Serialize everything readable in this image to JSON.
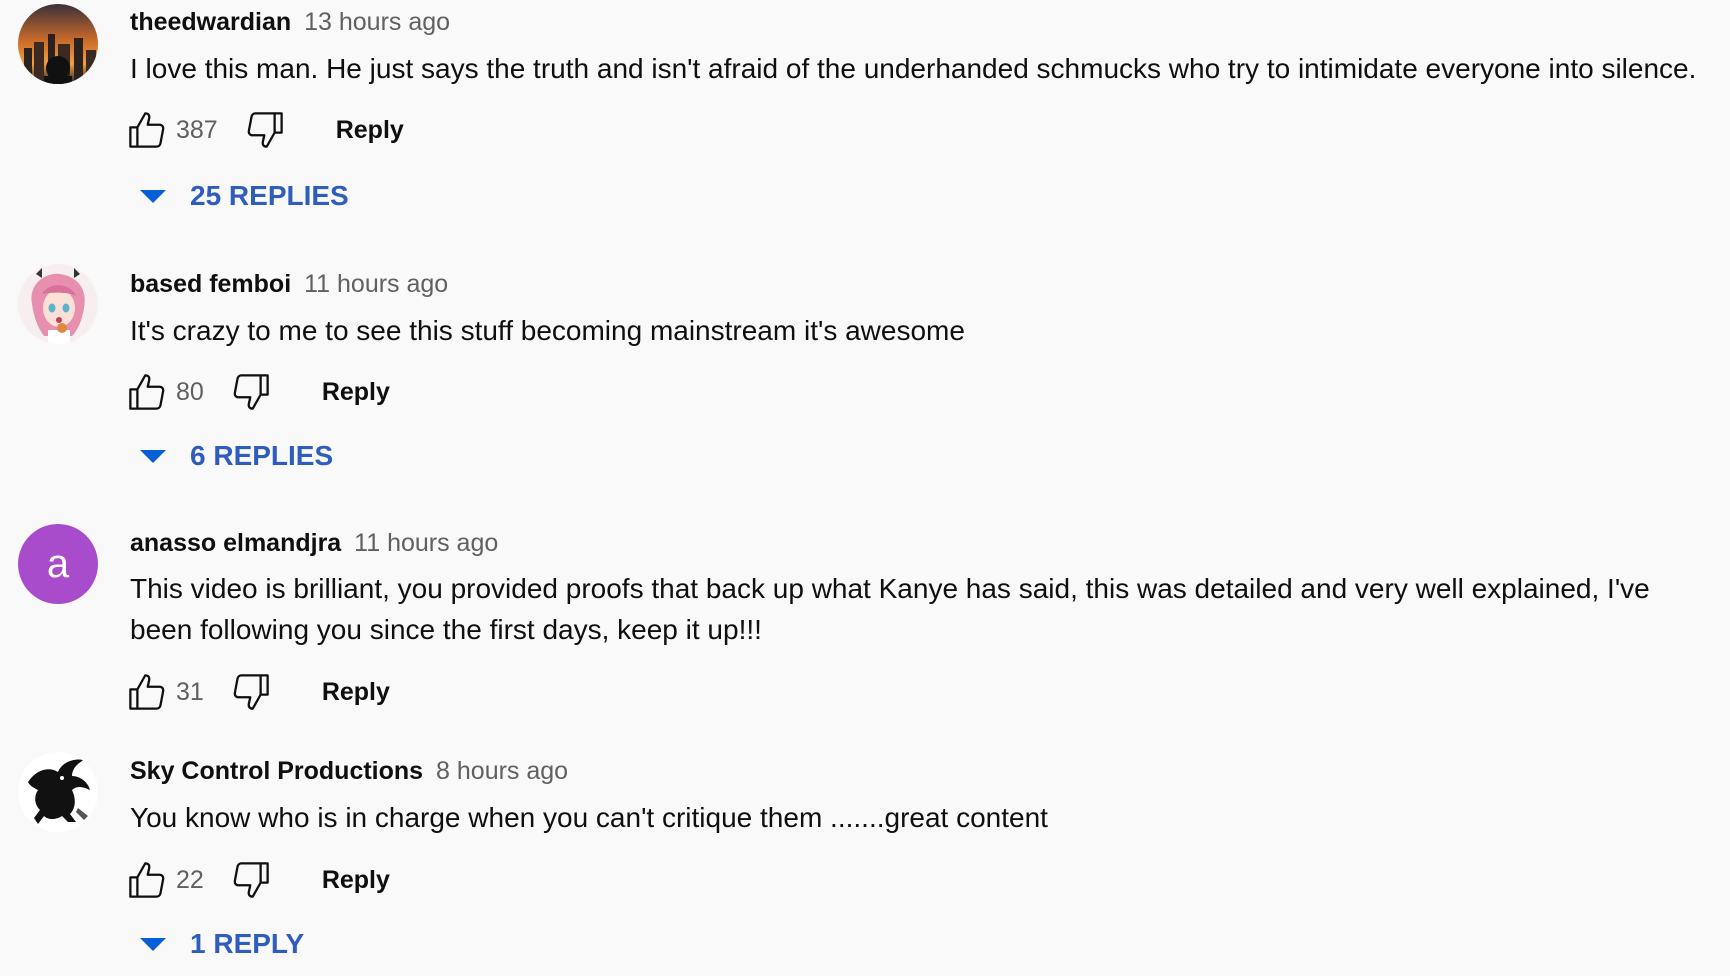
{
  "comments": [
    {
      "author": "theedwardian",
      "time": "13 hours ago",
      "text": "I love this man. He just says the truth and isn't afraid of the underhanded schmucks who try to intimidate everyone into silence.",
      "likes": "387",
      "reply_label": "Reply",
      "replies_label": "25 REPLIES",
      "avatar_icon": "city-skyline-sunset-avatar"
    },
    {
      "author": "based femboi",
      "time": "11 hours ago",
      "text": "It's crazy to me to see this stuff becoming mainstream it's awesome",
      "likes": "80",
      "reply_label": "Reply",
      "replies_label": "6 REPLIES",
      "avatar_icon": "anime-character-avatar"
    },
    {
      "author": "anasso elmandjra",
      "time": "11 hours ago",
      "text": "This video is brilliant, you provided proofs that back up what Kanye has said, this was detailed and very well explained, I've been following you since the first days, keep it up!!!",
      "likes": "31",
      "reply_label": "Reply",
      "avatar_letter": "a",
      "avatar_color": "#a94ccc"
    },
    {
      "author": "Sky Control Productions",
      "time": "8 hours ago",
      "text": "You know who is in charge when you can't critique them .......great content",
      "likes": "22",
      "reply_label": "Reply",
      "replies_label": "1 REPLY",
      "avatar_icon": "black-dragon-avatar"
    }
  ],
  "colors": {
    "background": "#f9f9f9",
    "replies_link": "#2f5dbd",
    "meta_text": "#606060"
  }
}
